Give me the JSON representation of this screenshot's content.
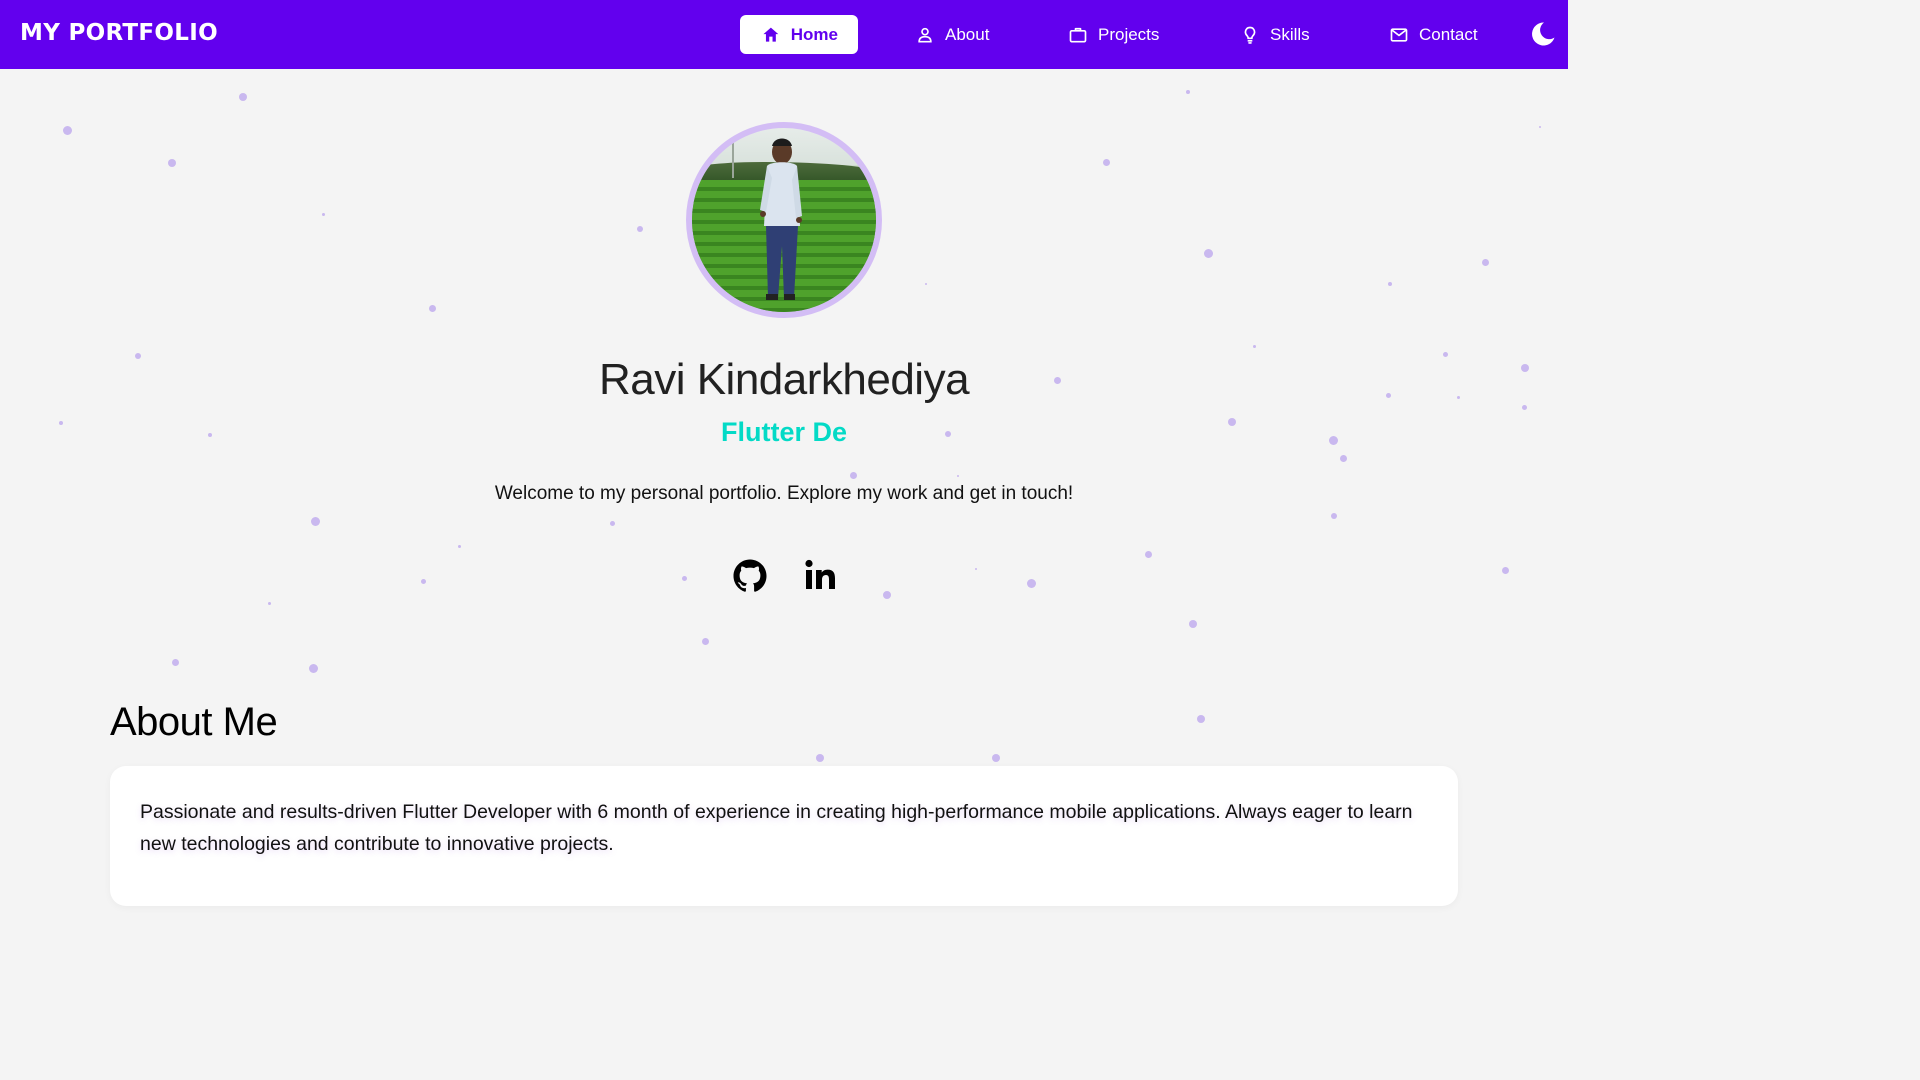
{
  "navbar": {
    "brand": "MY PORTFOLIO",
    "items": [
      {
        "label": "Home",
        "icon": "home-icon",
        "active": true
      },
      {
        "label": "About",
        "icon": "user-icon",
        "active": false
      },
      {
        "label": "Projects",
        "icon": "briefcase-icon",
        "active": false
      },
      {
        "label": "Skills",
        "icon": "lightbulb-icon",
        "active": false
      },
      {
        "label": "Contact",
        "icon": "mail-icon",
        "active": false
      }
    ],
    "theme_toggle_icon": "moon-icon"
  },
  "hero": {
    "name": "Ravi Kindarkhediya",
    "role": "Flutter De",
    "welcome": "Welcome to my personal portfolio. Explore my work and get in touch!",
    "avatar_icon": "profile-photo",
    "social": [
      {
        "name": "GitHub",
        "icon": "github-icon"
      },
      {
        "name": "LinkedIn",
        "icon": "linkedin-icon"
      }
    ]
  },
  "about": {
    "title": "About Me",
    "text": "Passionate and results-driven Flutter Developer with 6 month of experience in creating high-performance mobile applications. Always eager to learn new technologies and contribute to innovative projects."
  },
  "colors": {
    "primary": "#6200ee",
    "accent": "#03dac6",
    "background": "#f4f4f4",
    "particle": "#c9b8ef",
    "avatar_ring": "#d3bdf5"
  }
}
